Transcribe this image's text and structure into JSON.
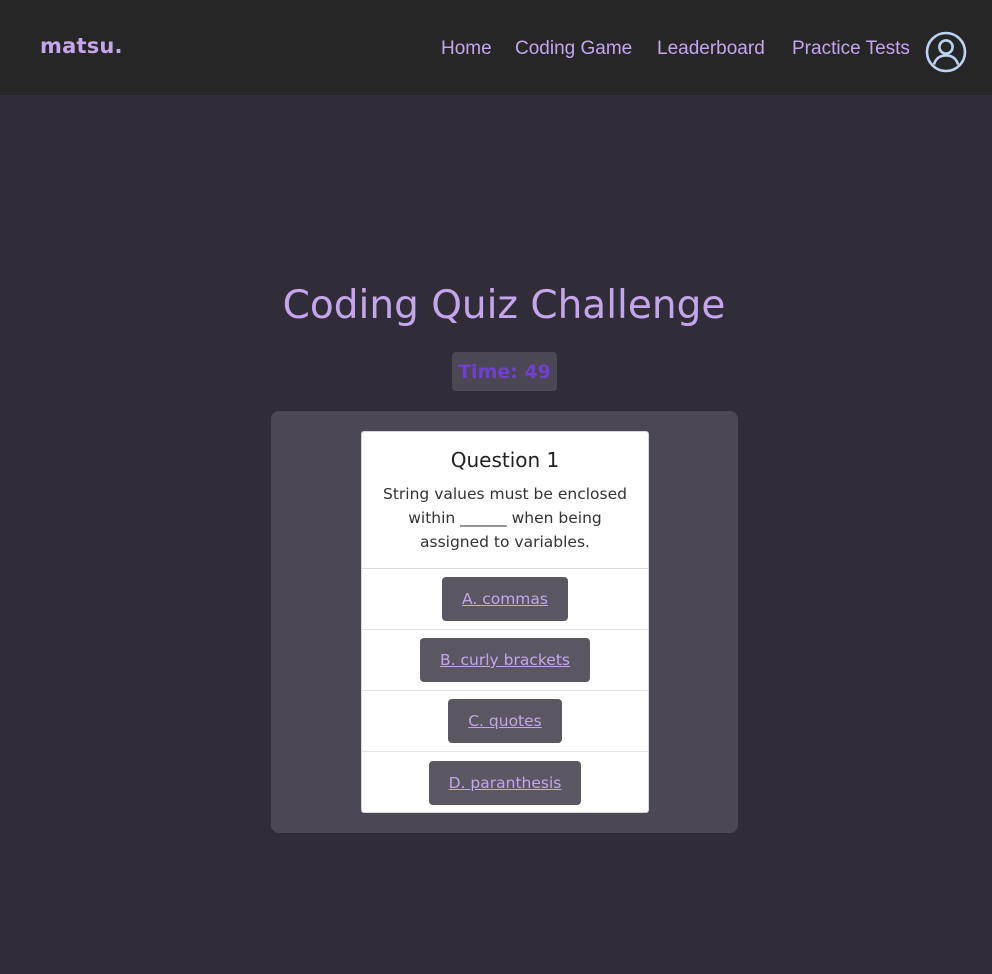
{
  "navbar": {
    "brand": "matsu",
    "brand_dot": ".",
    "links": [
      {
        "label": "Home"
      },
      {
        "label": "Coding Game"
      },
      {
        "label": "Leaderboard"
      },
      {
        "label": "Practice Tests"
      }
    ],
    "profile_icon": "user-circle-icon"
  },
  "quiz": {
    "title": "Coding Quiz Challenge",
    "timer": "Time: 49",
    "question_title": "Question 1",
    "question_text": "String values must be enclosed within ______ when being assigned to variables.",
    "answers": [
      {
        "label": "A. commas"
      },
      {
        "label": "B. curly brackets"
      },
      {
        "label": "C. quotes"
      },
      {
        "label": "D. paranthesis"
      }
    ]
  },
  "colors": {
    "background": "#302d38",
    "navbar": "#262626",
    "accent": "#c4a6ec",
    "timer_text": "#6f3fd0",
    "panel": "#4b4755",
    "button": "#5a5662"
  }
}
